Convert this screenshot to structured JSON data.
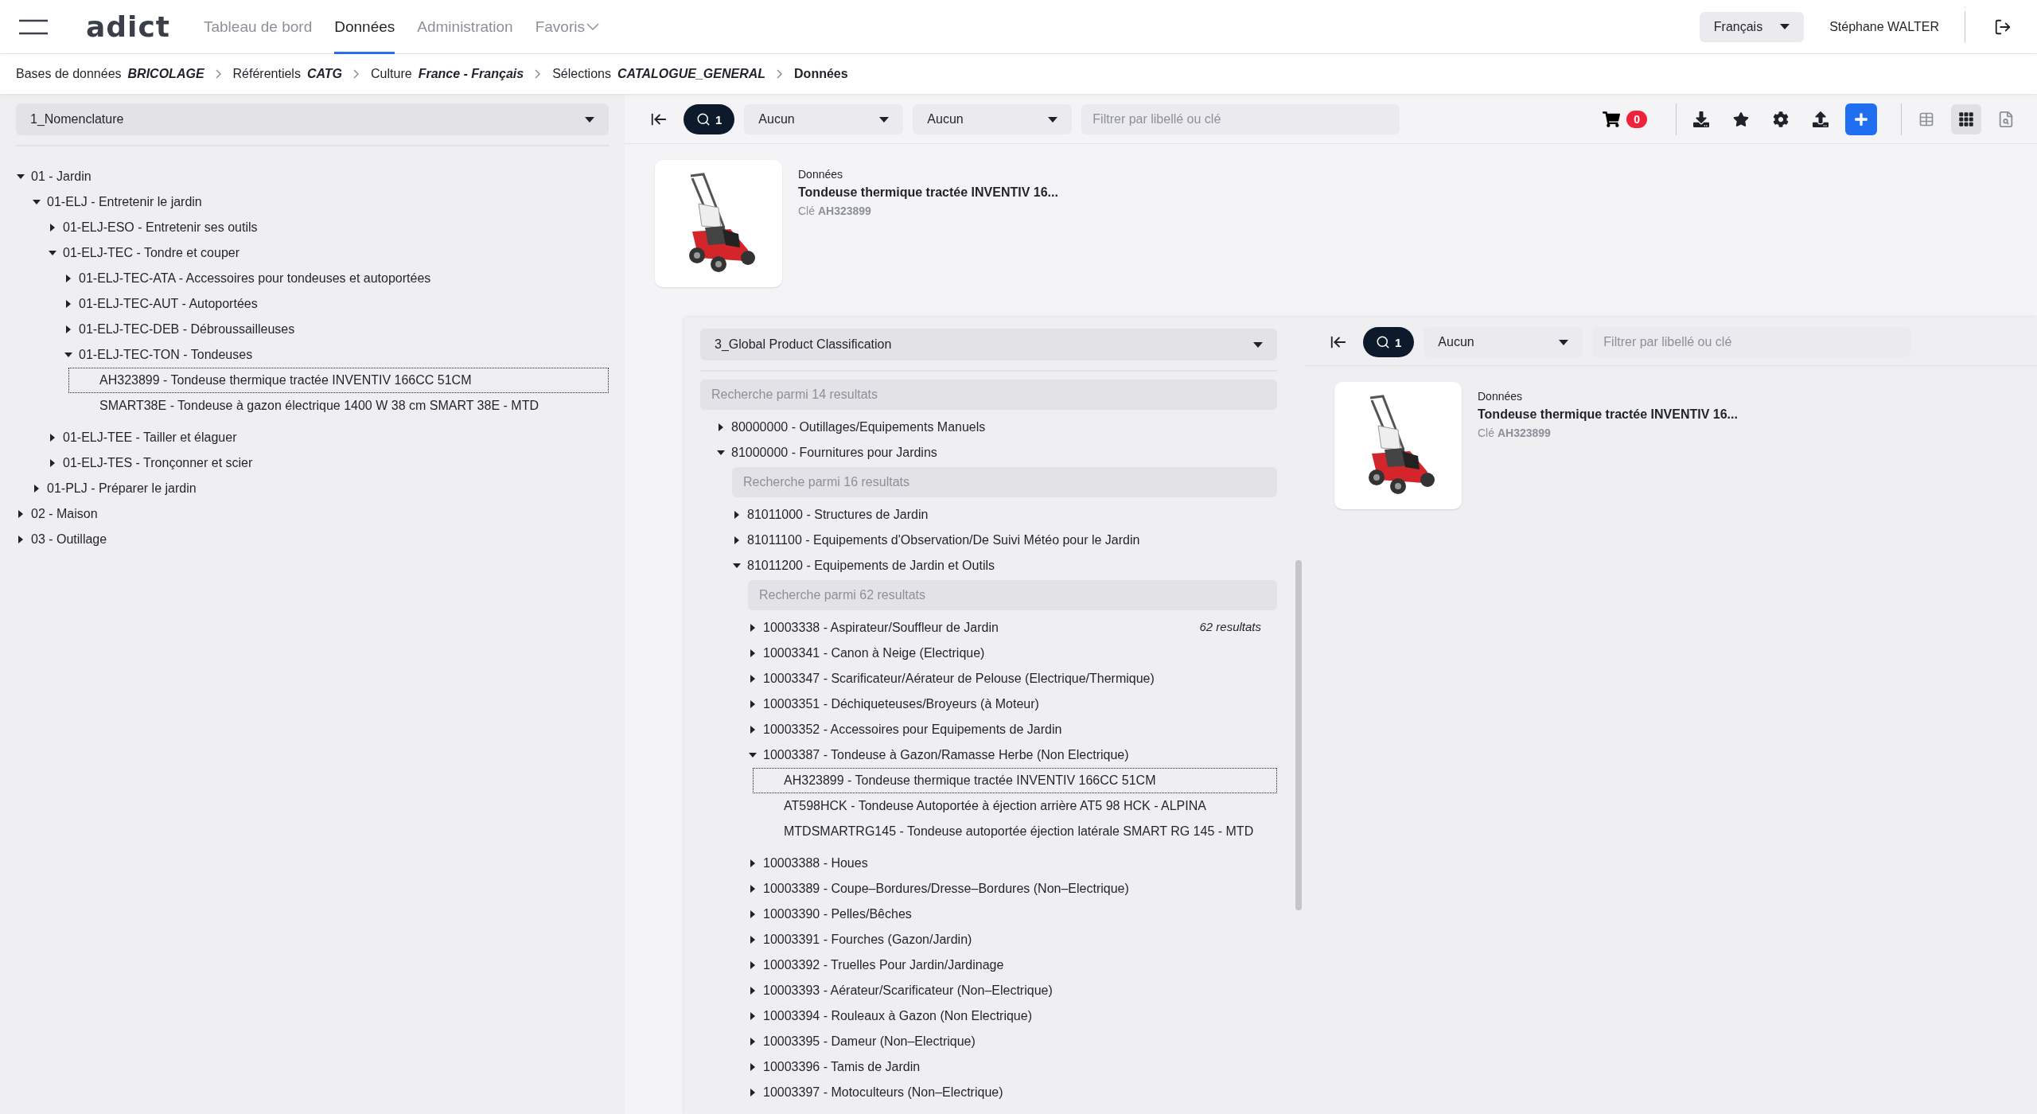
{
  "nav": {
    "logo": "adict",
    "tabs": [
      {
        "label": "Tableau de bord",
        "selected": false,
        "kind": "link"
      },
      {
        "label": "Données",
        "selected": true,
        "kind": "link"
      },
      {
        "label": "Administration",
        "selected": false,
        "kind": "link"
      },
      {
        "label": "Favoris",
        "selected": false,
        "kind": "menu"
      }
    ],
    "language": "Français",
    "user": "Stéphane WALTER"
  },
  "breadcrumb": [
    {
      "label": "Bases de données",
      "value": "BRICOLAGE",
      "kind": "link"
    },
    {
      "label": "Référentiels",
      "value": "CATG",
      "kind": "link"
    },
    {
      "label": "Culture",
      "value": "France - Français",
      "kind": "link"
    },
    {
      "label": "Sélections",
      "value": "CATALOGUE_GENERAL",
      "kind": "link"
    },
    {
      "label": "Données",
      "kind": "current"
    }
  ],
  "left_panel": {
    "classification": "1_Nomenclature",
    "tree": [
      {
        "label": "01 - Jardin",
        "kind": "folder",
        "expanded": true,
        "children": [
          {
            "label": "01-ELJ - Entretenir le jardin",
            "kind": "folder",
            "expanded": true,
            "children": [
              {
                "label": "01-ELJ-ESO - Entretenir ses outils",
                "kind": "folder",
                "expanded": false
              },
              {
                "label": "01-ELJ-TEC - Tondre et couper",
                "kind": "folder",
                "expanded": true,
                "children": [
                  {
                    "label": "01-ELJ-TEC-ATA - Accessoires pour tondeuses et autoportées",
                    "kind": "folder",
                    "expanded": false
                  },
                  {
                    "label": "01-ELJ-TEC-AUT - Autoportées",
                    "kind": "folder",
                    "expanded": false
                  },
                  {
                    "label": "01-ELJ-TEC-DEB - Débroussailleuses",
                    "kind": "folder",
                    "expanded": false
                  },
                  {
                    "label": "01-ELJ-TEC-TON - Tondeuses",
                    "kind": "folder",
                    "expanded": true,
                    "children": [
                      {
                        "label": "AH323899 - Tondeuse thermique tractée INVENTIV 166CC 51CM",
                        "kind": "item",
                        "selected": true
                      },
                      {
                        "label": "SMART38E - Tondeuse à gazon électrique 1400 W 38 cm SMART 38E - MTD",
                        "kind": "item",
                        "selected": false
                      }
                    ]
                  }
                ]
              },
              {
                "label": "01-ELJ-TEE - Tailler et élaguer",
                "kind": "folder",
                "expanded": false
              },
              {
                "label": "01-ELJ-TES - Tronçonner et scier",
                "kind": "folder",
                "expanded": false
              }
            ]
          },
          {
            "label": "01-PLJ - Préparer le jardin",
            "kind": "folder",
            "expanded": false
          }
        ]
      },
      {
        "label": "02 - Maison",
        "kind": "folder",
        "expanded": false
      },
      {
        "label": "03 - Outillage",
        "kind": "folder",
        "expanded": false
      }
    ]
  },
  "toolbar": {
    "search_count": "1",
    "filters": [
      "Aucun",
      "Aucun"
    ],
    "filter_placeholder": "Filtrer par libellé ou clé",
    "cart_count": "0",
    "views": [
      {
        "kind": "table",
        "selected": false
      },
      {
        "kind": "grid",
        "selected": true
      },
      {
        "kind": "preview",
        "selected": false
      }
    ]
  },
  "card": {
    "section": "Données",
    "title": "Tondeuse thermique tractée INVENTIV 16...",
    "key_label": "Clé",
    "key": "AH323899"
  },
  "nested_panel": {
    "classification": "3_Global Product Classification",
    "search_placeholder": "Recherche parmi 14 resultats",
    "tree": [
      {
        "label": "80000000 - Outillages/Equipements Manuels",
        "kind": "folder",
        "expanded": false
      },
      {
        "label": "81000000 - Fournitures pour Jardins",
        "kind": "folder",
        "expanded": true,
        "search_placeholder": "Recherche parmi 16 resultats",
        "children": [
          {
            "label": "81011000 - Structures de Jardin",
            "kind": "folder",
            "expanded": false
          },
          {
            "label": "81011100 - Equipements d'Observation/De Suivi Météo pour le Jardin",
            "kind": "folder",
            "expanded": false
          },
          {
            "label": "81011200 - Equipements de Jardin et Outils",
            "kind": "folder",
            "expanded": true,
            "search_placeholder": "Recherche parmi 62 resultats",
            "count": "62 resultats",
            "children": [
              {
                "label": "10003338 - Aspirateur/Souffleur de Jardin",
                "kind": "folder",
                "expanded": false
              },
              {
                "label": "10003341 - Canon à Neige (Electrique)",
                "kind": "folder",
                "expanded": false
              },
              {
                "label": "10003347 - Scarificateur/Aérateur de Pelouse (Electrique/Thermique)",
                "kind": "folder",
                "expanded": false
              },
              {
                "label": "10003351 - Déchiqueteuses/Broyeurs (à Moteur)",
                "kind": "folder",
                "expanded": false
              },
              {
                "label": "10003352 - Accessoires pour Equipements de Jardin",
                "kind": "folder",
                "expanded": false
              },
              {
                "label": "10003387 - Tondeuse à Gazon/Ramasse Herbe (Non Electrique)",
                "kind": "folder",
                "expanded": true,
                "children": [
                  {
                    "label": "AH323899 - Tondeuse thermique tractée INVENTIV 166CC 51CM",
                    "kind": "item",
                    "selected": true
                  },
                  {
                    "label": "AT598HCK - Tondeuse Autoportée à éjection arrière AT5 98 HCK - ALPINA",
                    "kind": "item",
                    "selected": false
                  },
                  {
                    "label": "MTDSMARTRG145 - Tondeuse autoportée éjection latérale SMART RG 145 - MTD",
                    "kind": "item",
                    "selected": false
                  }
                ]
              },
              {
                "label": "10003388 - Houes",
                "kind": "folder",
                "expanded": false
              },
              {
                "label": "10003389 - Coupe–Bordures/Dresse–Bordures (Non–Electrique)",
                "kind": "folder",
                "expanded": false
              },
              {
                "label": "10003390 - Pelles/Bêches",
                "kind": "folder",
                "expanded": false
              },
              {
                "label": "10003391 - Fourches (Gazon/Jardin)",
                "kind": "folder",
                "expanded": false
              },
              {
                "label": "10003392 - Truelles Pour Jardin/Jardinage",
                "kind": "folder",
                "expanded": false
              },
              {
                "label": "10003393 - Aérateur/Scarificateur (Non–Electrique)",
                "kind": "folder",
                "expanded": false
              },
              {
                "label": "10003394 - Rouleaux à Gazon (Non Electrique)",
                "kind": "folder",
                "expanded": false
              },
              {
                "label": "10003395 - Dameur (Non–Electrique)",
                "kind": "folder",
                "expanded": false
              },
              {
                "label": "10003396 - Tamis de Jardin",
                "kind": "folder",
                "expanded": false
              },
              {
                "label": "10003397 - Motoculteurs (Non–Electrique)",
                "kind": "folder",
                "expanded": false
              }
            ]
          }
        ]
      }
    ],
    "toolbar": {
      "search_count": "1",
      "filters": [
        "Aucun"
      ],
      "filter_placeholder": "Filtrer par libellé ou clé"
    },
    "card": {
      "section": "Données",
      "title": "Tondeuse thermique tractée INVENTIV 16...",
      "key_label": "Clé",
      "key": "AH323899"
    }
  }
}
